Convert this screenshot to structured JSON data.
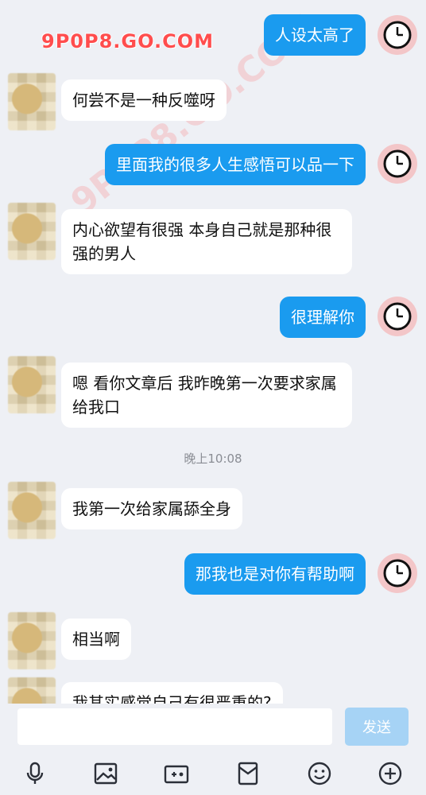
{
  "watermark": {
    "text": "9P0P8.GO.COM"
  },
  "messages": [
    {
      "side": "right",
      "text": "人设太高了"
    },
    {
      "side": "left",
      "text": "何尝不是一种反噬呀"
    },
    {
      "side": "right",
      "text": "里面我的很多人生感悟可以品一下"
    },
    {
      "side": "left",
      "text": "内心欲望有很强 本身自己就是那种很强的男人"
    },
    {
      "side": "right",
      "text": "很理解你"
    },
    {
      "side": "left",
      "text": "嗯  看你文章后 我昨晚第一次要求家属给我口"
    },
    {
      "side": "left",
      "text": "我第一次给家属舔全身"
    },
    {
      "side": "right",
      "text": "那我也是对你有帮助啊"
    },
    {
      "side": "left",
      "text": "相当啊"
    },
    {
      "side": "left",
      "text": "我其实感觉自己有很严重的?"
    }
  ],
  "timestamp": "晚上10:08",
  "composer": {
    "value": "",
    "placeholder": "",
    "send_label": "发送"
  },
  "toolbar": {
    "icons": [
      "microphone-icon",
      "image-icon",
      "camera-icon",
      "red-packet-icon",
      "emoji-icon",
      "plus-icon"
    ]
  },
  "colors": {
    "background": "#eef0f5",
    "outgoing_bubble": "#1a9bef",
    "incoming_bubble": "#ffffff",
    "send_button": "#a6d3f5",
    "avatar_ring": "#f3c6c8"
  }
}
